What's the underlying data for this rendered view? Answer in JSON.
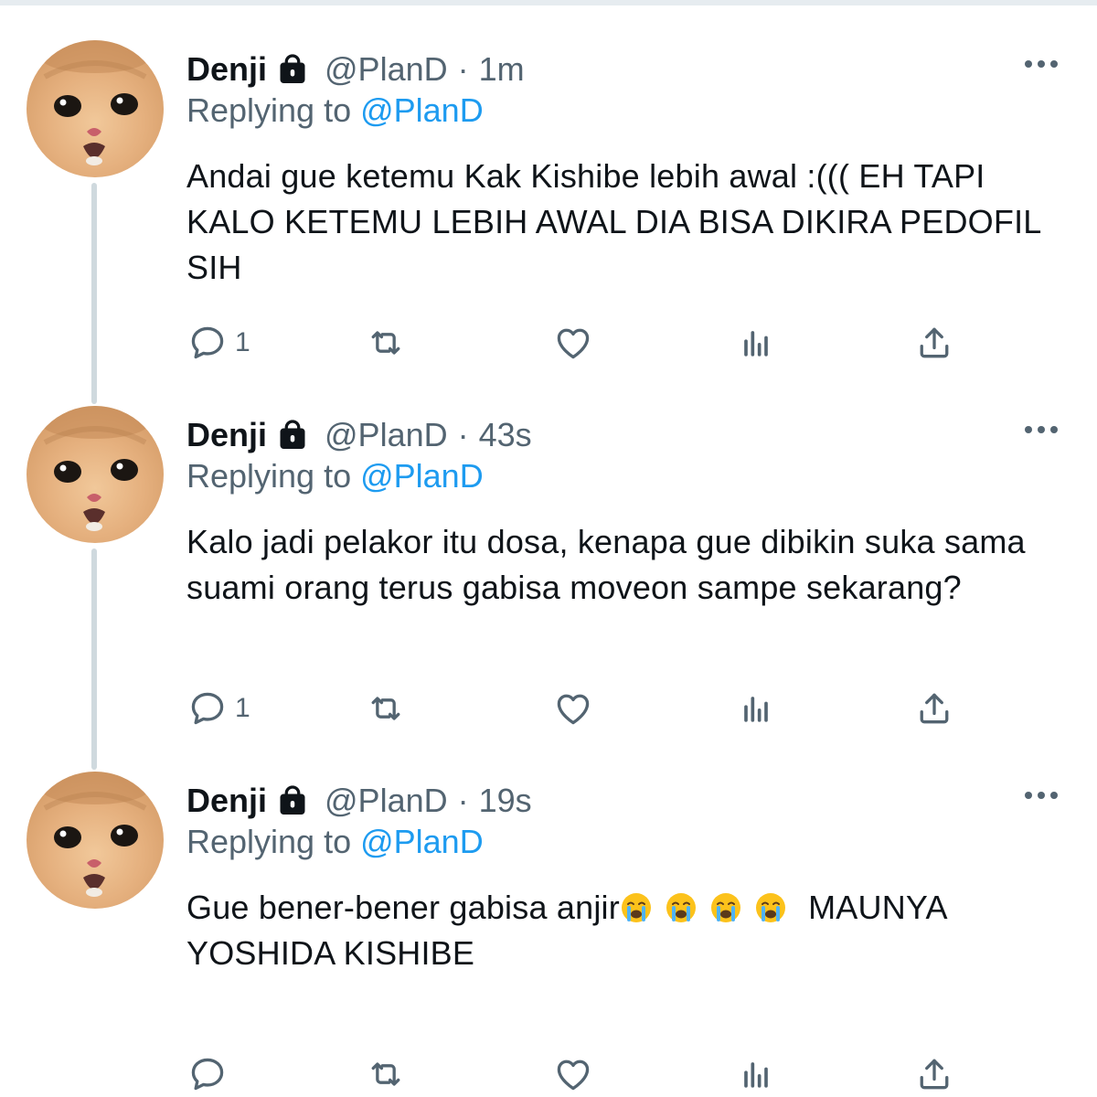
{
  "colors": {
    "text": "#0f1419",
    "secondary": "#536471",
    "mention": "#1d9bf0",
    "thread_line": "#cfd9de"
  },
  "tweets": [
    {
      "name": "Denji",
      "handle": "@PlanD",
      "separator": "·",
      "time": "1m",
      "replying_prefix": "Replying to ",
      "replying_to": "@PlanD",
      "text": "Andai gue ketemu Kak Kishibe lebih awal :((( EH TAPI KALO KETEMU LEBIH AWAL DIA BISA DIKIRA PEDOFIL SIH",
      "text_suffix": "",
      "emoji": [],
      "reply_count": "1",
      "icons": [
        "reply-icon",
        "retweet-icon",
        "like-icon",
        "analytics-icon",
        "share-icon"
      ]
    },
    {
      "name": "Denji",
      "handle": "@PlanD",
      "separator": "·",
      "time": "43s",
      "replying_prefix": "Replying to ",
      "replying_to": "@PlanD",
      "text": "Kalo jadi pelakor itu dosa, kenapa gue dibikin suka sama suami orang terus gabisa moveon sampe sekarang?",
      "text_suffix": "",
      "emoji": [],
      "reply_count": "1",
      "icons": [
        "reply-icon",
        "retweet-icon",
        "like-icon",
        "analytics-icon",
        "share-icon"
      ]
    },
    {
      "name": "Denji",
      "handle": "@PlanD",
      "separator": "·",
      "time": "19s",
      "replying_prefix": "Replying to ",
      "replying_to": "@PlanD",
      "text": "Gue bener-bener gabisa anjir",
      "text_suffix": " MAUNYA YOSHIDA KISHIBE",
      "emoji": [
        "loudly-crying-face",
        "loudly-crying-face",
        "loudly-crying-face",
        "loudly-crying-face"
      ],
      "reply_count": "",
      "icons": [
        "reply-icon",
        "retweet-icon",
        "like-icon",
        "analytics-icon",
        "share-icon"
      ]
    }
  ]
}
